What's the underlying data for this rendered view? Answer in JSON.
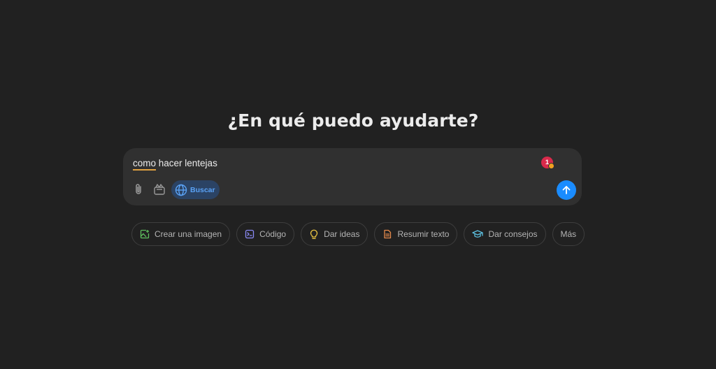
{
  "heading": "¿En qué puedo ayudarte?",
  "composer": {
    "prompt_first_word": "como",
    "prompt_rest": " hacer lentejas",
    "grammar_count": "1",
    "search_label": "Buscar"
  },
  "suggestions": {
    "create_image": "Crear una imagen",
    "code": "Código",
    "ideas": "Dar ideas",
    "summarize": "Resumir texto",
    "advice": "Dar consejos",
    "more": "Más"
  },
  "icons": {
    "attach": "paperclip-icon",
    "tools": "tools-icon",
    "search": "globe-icon",
    "send": "arrow-up-icon",
    "create_image": "image-icon",
    "code": "terminal-icon",
    "ideas": "lightbulb-icon",
    "summarize": "document-icon",
    "advice": "graduation-cap-icon"
  },
  "colors": {
    "background": "#212121",
    "composer": "#303030",
    "send": "#1a8cff",
    "search_bg": "#2b4364",
    "search_text": "#5aa2f5",
    "image_icon": "#5fbf5f",
    "code_icon": "#8a8af5",
    "ideas_icon": "#e8c341",
    "summarize_icon": "#e58a4b",
    "advice_icon": "#5cc0e0",
    "grammar_badge": "#d92a4b"
  }
}
